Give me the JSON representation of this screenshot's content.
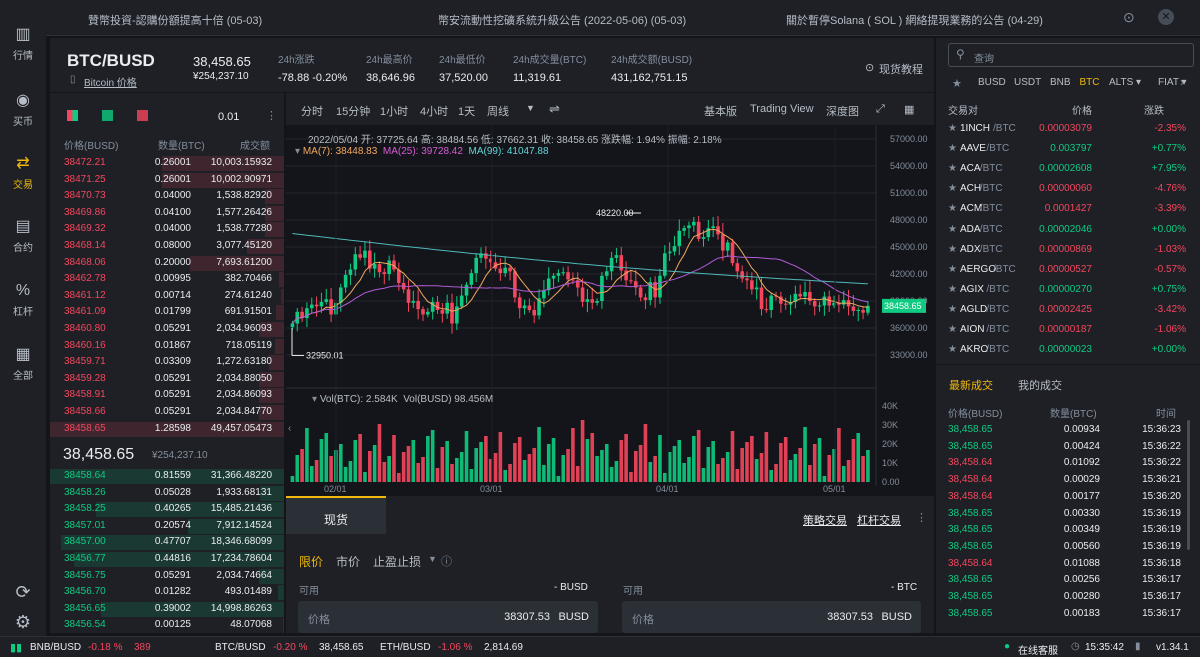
{
  "sidebar": {
    "items": [
      {
        "label": "行情",
        "icon": "bar-chart-icon"
      },
      {
        "label": "买币",
        "icon": "coins-icon"
      },
      {
        "label": "交易",
        "icon": "exchange-icon"
      },
      {
        "label": "合约",
        "icon": "contract-icon"
      },
      {
        "label": "杠杆",
        "icon": "percent-icon"
      },
      {
        "label": "全部",
        "icon": "grid-icon"
      }
    ]
  },
  "topbar": {
    "announcements": [
      "贊幣投資-認購份額提高十倍  (05-03)",
      "幣安流動性挖礦系統升級公告 (2022-05-06)  (05-03)",
      "關於暫停Solana ( SOL ) 網絡提現業務的公告  (04-29)"
    ]
  },
  "header": {
    "pair": "BTC/BUSD",
    "sub_link": "Bitcoin 价格",
    "price": "38,458.65",
    "price_cny": "¥254,237.10",
    "stats": [
      {
        "label": "24h涨跌",
        "value": "-78.88 -0.20%",
        "color": "red"
      },
      {
        "label": "24h最高价",
        "value": "38,646.96"
      },
      {
        "label": "24h最低价",
        "value": "37,520.00"
      },
      {
        "label": "24h成交量(BTC)",
        "value": "11,319.61"
      },
      {
        "label": "24h成交额(BUSD)",
        "value": "431,162,751.15"
      }
    ],
    "tutorial": "现货教程"
  },
  "orderbook": {
    "precision": "0.01",
    "headers": [
      "价格(BUSD)",
      "数量(BTC)",
      "成交额"
    ],
    "asks": [
      [
        "38472.21",
        "0.26001",
        "10,003.15932"
      ],
      [
        "38471.25",
        "0.26001",
        "10,002.90971"
      ],
      [
        "38470.73",
        "0.04000",
        "1,538.82920"
      ],
      [
        "38469.86",
        "0.04100",
        "1,577.26426"
      ],
      [
        "38469.32",
        "0.04000",
        "1,538.77280"
      ],
      [
        "38468.14",
        "0.08000",
        "3,077.45120"
      ],
      [
        "38468.06",
        "0.20000",
        "7,693.61200"
      ],
      [
        "38462.78",
        "0.00995",
        "382.70466"
      ],
      [
        "38461.12",
        "0.00714",
        "274.61240"
      ],
      [
        "38461.09",
        "0.01799",
        "691.91501"
      ],
      [
        "38460.80",
        "0.05291",
        "2,034.96093"
      ],
      [
        "38460.16",
        "0.01867",
        "718.05119"
      ],
      [
        "38459.71",
        "0.03309",
        "1,272.63180"
      ],
      [
        "38459.28",
        "0.05291",
        "2,034.88050"
      ],
      [
        "38458.91",
        "0.05291",
        "2,034.86093"
      ],
      [
        "38458.66",
        "0.05291",
        "2,034.84770"
      ],
      [
        "38458.65",
        "1.28598",
        "49,457.05473"
      ]
    ],
    "last_price": "38,458.65",
    "last_cny": "¥254,237.10",
    "bids": [
      [
        "38458.64",
        "0.81559",
        "31,366.48220"
      ],
      [
        "38458.26",
        "0.05028",
        "1,933.68131"
      ],
      [
        "38458.25",
        "0.40265",
        "15,485.21436"
      ],
      [
        "38457.01",
        "0.20574",
        "7,912.14524"
      ],
      [
        "38457.00",
        "0.47707",
        "18,346.68099"
      ],
      [
        "38456.77",
        "0.44816",
        "17,234.78604"
      ],
      [
        "38456.75",
        "0.05291",
        "2,034.74664"
      ],
      [
        "38456.70",
        "0.01282",
        "493.01489"
      ],
      [
        "38456.65",
        "0.39002",
        "14,998.86263"
      ],
      [
        "38456.54",
        "0.00125",
        "48.07068"
      ]
    ]
  },
  "chart": {
    "timeframes": [
      "分时",
      "15分钟",
      "1小时",
      "4小时",
      "1天",
      "周线"
    ],
    "active_tf": "1天",
    "views": [
      "基本版",
      "Trading View",
      "深度图"
    ],
    "ohlc_line": "2022/05/04 开: 37725.64 高: 38484.56 低: 37662.31 收: 38458.65 涨跌幅: 1.94% 振幅: 2.18%",
    "ma_labels": [
      "MA(7): 38448.83",
      "MA(25): 39728.42",
      "MA(99): 41047.88"
    ],
    "vol_labels": [
      "Vol(BTC): 2.584K",
      "Vol(BUSD) 98.456M"
    ],
    "y_ticks": [
      "57000.00",
      "54000.00",
      "51000.00",
      "48000.00",
      "45000.00",
      "42000.00",
      "39000.00",
      "36000.00",
      "33000.00"
    ],
    "vol_ticks": [
      "40K",
      "30K",
      "20K",
      "10K",
      "0.00"
    ],
    "x_ticks": [
      "02/01",
      "03/01",
      "04/01",
      "05/01"
    ],
    "high_label": "48220.00",
    "low_label": "32950.01",
    "current_label": "38458.65"
  },
  "chart_data": {
    "type": "candlestick",
    "y_range": [
      30000,
      58000
    ],
    "closes": [
      36500,
      37800,
      37100,
      38200,
      38600,
      38400,
      38900,
      39200,
      37500,
      38800,
      40500,
      41900,
      42500,
      44200,
      43800,
      44600,
      42600,
      43100,
      42200,
      42000,
      43500,
      42500,
      41000,
      40300,
      38800,
      39000,
      38100,
      37500,
      37800,
      38900,
      38000,
      37600,
      38800,
      36500,
      38400,
      39600,
      40800,
      42100,
      43800,
      44300,
      43700,
      43300,
      42600,
      42100,
      42700,
      42300,
      39400,
      38200,
      38500,
      38000,
      37400,
      39300,
      40200,
      41500,
      41800,
      42100,
      42200,
      41400,
      41300,
      40500,
      38900,
      39200,
      38800,
      39000,
      41800,
      42300,
      43800,
      44100,
      42400,
      41300,
      41200,
      40500,
      39400,
      39100,
      41100,
      39400,
      41800,
      44300,
      44500,
      45100,
      46800,
      47100,
      47400,
      47800,
      45900,
      46100,
      47100,
      47300,
      46400,
      44600,
      45500,
      43200,
      42300,
      41500,
      41300,
      40300,
      40500,
      38100,
      38000,
      39600,
      39500,
      38700,
      38600,
      38900,
      39800,
      39500,
      40000,
      39000,
      38400,
      38500,
      39500,
      38500,
      38800,
      38600,
      39100,
      38400,
      37900,
      38000,
      37700,
      38458
    ]
  },
  "trade": {
    "tab": "现货",
    "links": [
      "策略交易",
      "杠杆交易"
    ],
    "order_types": [
      "限价",
      "市价",
      "止盈止损"
    ],
    "avail_label": "可用",
    "buy_avail": "- BUSD",
    "sell_avail": "- BTC",
    "price_label": "价格",
    "buy_price": "38307.53",
    "sell_price": "38307.53",
    "unit": "BUSD"
  },
  "markets": {
    "search_placeholder": "查询",
    "tabs": [
      "BUSD",
      "USDT",
      "BNB",
      "BTC",
      "ALTS ▾",
      "FIAT ▾"
    ],
    "active_tab": "BTC",
    "headers": [
      "交易对",
      "价格",
      "涨跌"
    ],
    "rows": [
      [
        "1INCH",
        "0.00003079",
        "-2.35%"
      ],
      [
        "AAVE",
        "0.003797",
        "+0.77%"
      ],
      [
        "ACA",
        "0.00002608",
        "+7.95%"
      ],
      [
        "ACH",
        "0.00000060",
        "-4.76%"
      ],
      [
        "ACM",
        "0.0001427",
        "-3.39%"
      ],
      [
        "ADA",
        "0.00002046",
        "+0.00%"
      ],
      [
        "ADX",
        "0.00000869",
        "-1.03%"
      ],
      [
        "AERGO",
        "0.00000527",
        "-0.57%"
      ],
      [
        "AGIX",
        "0.00000270",
        "+0.75%"
      ],
      [
        "AGLD",
        "0.00002425",
        "-3.42%"
      ],
      [
        "AION",
        "0.00000187",
        "-1.06%"
      ],
      [
        "AKRO",
        "0.00000023",
        "+0.00%"
      ]
    ],
    "quote": "/BTC"
  },
  "trades": {
    "tabs": [
      "最新成交",
      "我的成交"
    ],
    "headers": [
      "价格(BUSD)",
      "数量(BTC)",
      "时间"
    ],
    "rows": [
      [
        "38,458.65",
        "0.00934",
        "15:36:23",
        "g"
      ],
      [
        "38,458.65",
        "0.00424",
        "15:36:22",
        "g"
      ],
      [
        "38,458.64",
        "0.01092",
        "15:36:22",
        "r"
      ],
      [
        "38,458.64",
        "0.00029",
        "15:36:21",
        "r"
      ],
      [
        "38,458.64",
        "0.00177",
        "15:36:20",
        "r"
      ],
      [
        "38,458.65",
        "0.00330",
        "15:36:19",
        "g"
      ],
      [
        "38,458.65",
        "0.00349",
        "15:36:19",
        "g"
      ],
      [
        "38,458.65",
        "0.00560",
        "15:36:19",
        "g"
      ],
      [
        "38,458.64",
        "0.01088",
        "15:36:18",
        "r"
      ],
      [
        "38,458.65",
        "0.00256",
        "15:36:17",
        "g"
      ],
      [
        "38,458.65",
        "0.00280",
        "15:36:17",
        "g"
      ],
      [
        "38,458.65",
        "0.00183",
        "15:36:17",
        "g"
      ]
    ]
  },
  "footer": {
    "tickers": [
      [
        "BNB/BUSD",
        "-0.18 %",
        "389"
      ],
      [
        "BTC/BUSD",
        "-0.20 %",
        "38,458.65"
      ],
      [
        "ETH/BUSD",
        "-1.06 %",
        "2,814.69"
      ]
    ],
    "support": "在线客服",
    "time": "15:35:42",
    "version": "v1.34.1"
  }
}
